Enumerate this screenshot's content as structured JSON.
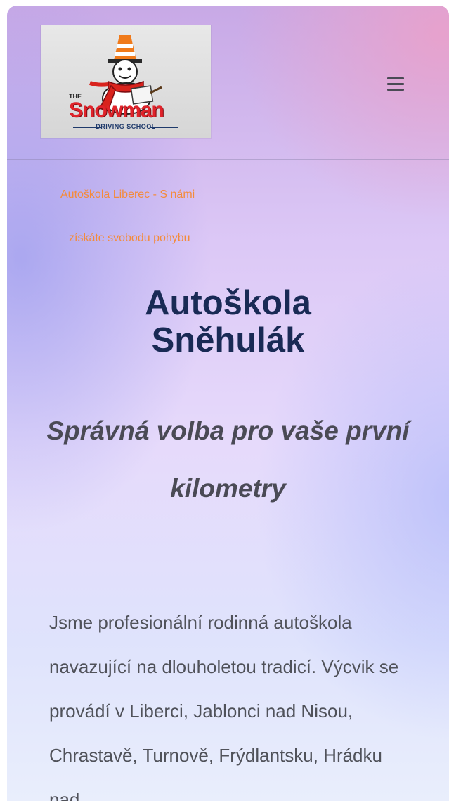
{
  "header": {
    "logo": {
      "the": "THE",
      "name": "Snowman",
      "subtitle": "DRIVING SCHOOL",
      "colors": {
        "name": "#e0232a",
        "scarf": "#d9231d",
        "cone": "#f07a1a"
      }
    },
    "menu_icon": "hamburger-menu-icon"
  },
  "hero": {
    "tagline_line1": "Autoškola Liberec - S námi",
    "tagline_line2": "získáte svobodu pohybu",
    "title_line1": "Autoškola",
    "title_line2": "Sněhulák",
    "subtitle": "Správná volba pro vaše první kilometry"
  },
  "intro": {
    "text": "Jsme profesionální rodinná autoškola navazující na dlouholetou tradicí. Výcvik se provádí v Liberci, Jablonci nad Nisou, Chrastavě, Turnově, Frýdlantsku, Hrádku nad"
  },
  "colors": {
    "tagline": "#f48b3b",
    "title": "#192a55",
    "subtitle": "#4a4a55",
    "body": "#50525a"
  }
}
